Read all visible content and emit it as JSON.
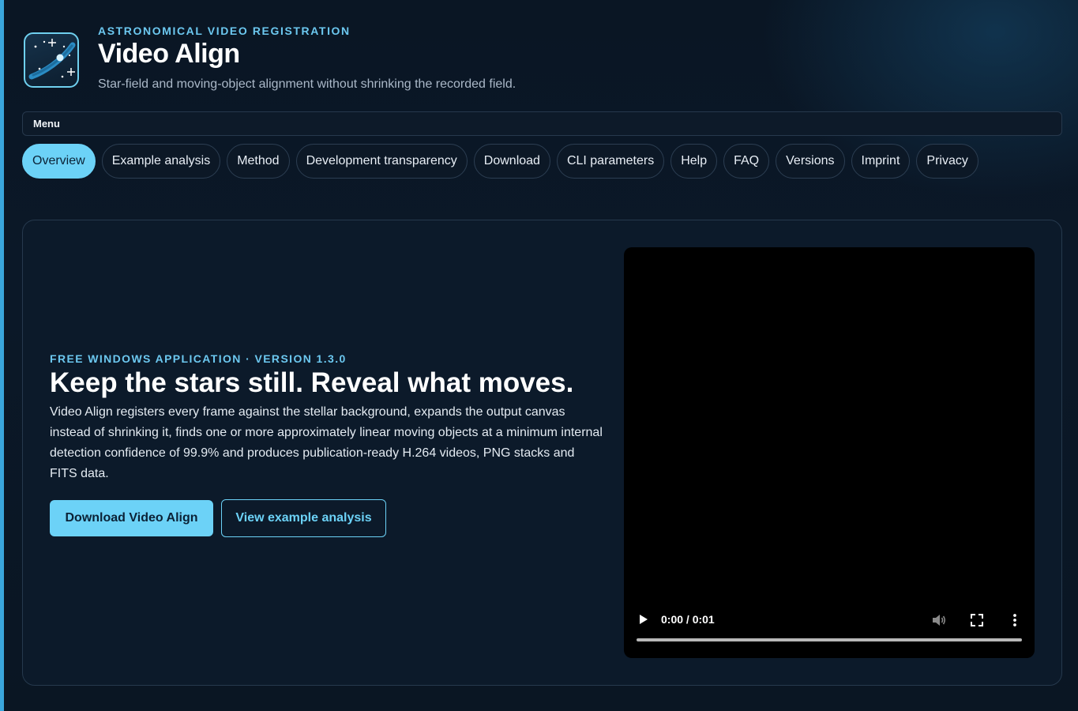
{
  "header": {
    "eyebrow": "ASTRONOMICAL VIDEO REGISTRATION",
    "title": "Video Align",
    "subtitle": "Star-field and moving-object alignment without shrinking the recorded field.",
    "logo_icon": "star-field-logo-icon"
  },
  "menu": {
    "label": "Menu"
  },
  "nav": {
    "tabs": [
      {
        "label": "Overview",
        "active": true
      },
      {
        "label": "Example analysis",
        "active": false
      },
      {
        "label": "Method",
        "active": false
      },
      {
        "label": "Development transparency",
        "active": false
      },
      {
        "label": "Download",
        "active": false
      },
      {
        "label": "CLI parameters",
        "active": false
      },
      {
        "label": "Help",
        "active": false
      },
      {
        "label": "FAQ",
        "active": false
      },
      {
        "label": "Versions",
        "active": false
      },
      {
        "label": "Imprint",
        "active": false
      },
      {
        "label": "Privacy",
        "active": false
      }
    ]
  },
  "hero": {
    "eyebrow": "FREE WINDOWS APPLICATION · VERSION 1.3.0",
    "title": "Keep the stars still. Reveal what moves.",
    "description": "Video Align registers every frame against the stellar background, expands the output canvas instead of shrinking it, finds one or more approximately linear moving objects at a minimum internal detection confidence of 99.9% and produces publication-ready H.264 videos, PNG stacks and FITS data.",
    "primary_button": "Download Video Align",
    "secondary_button": "View example analysis"
  },
  "video": {
    "time": "0:00 / 0:01",
    "progress": 0,
    "controls": [
      "play-icon",
      "volume-icon",
      "fullscreen-icon",
      "more-options-icon"
    ]
  },
  "colors": {
    "accent": "#6cd2f7",
    "background": "#0b1828",
    "panel": "#0c1a2a",
    "edge_strip": "#3aa6dc"
  }
}
